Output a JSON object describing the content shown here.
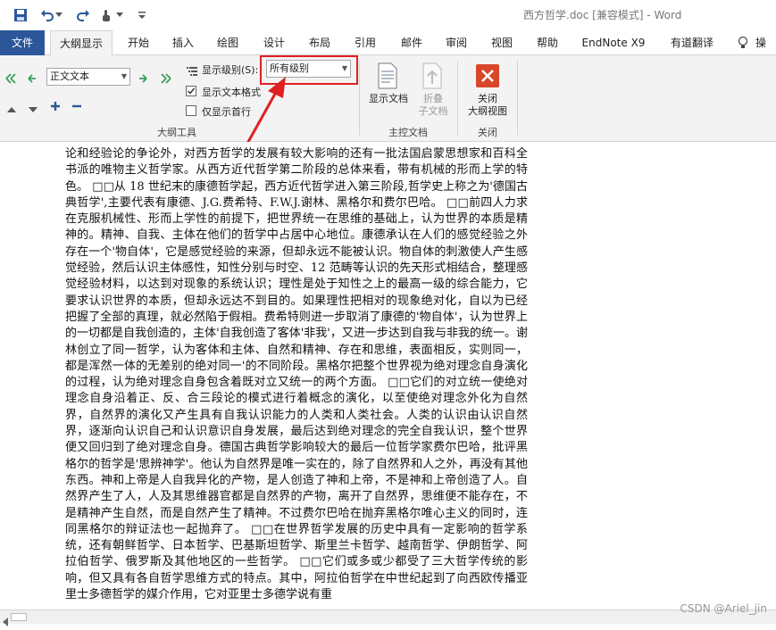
{
  "window": {
    "title": "西方哲学.doc [兼容模式] - Word"
  },
  "tabs": [
    {
      "label": "文件"
    },
    {
      "label": "大纲显示"
    },
    {
      "label": "开始"
    },
    {
      "label": "插入"
    },
    {
      "label": "绘图"
    },
    {
      "label": "设计"
    },
    {
      "label": "布局"
    },
    {
      "label": "引用"
    },
    {
      "label": "邮件"
    },
    {
      "label": "审阅"
    },
    {
      "label": "视图"
    },
    {
      "label": "帮助"
    },
    {
      "label": "EndNote X9"
    },
    {
      "label": "有道翻译"
    },
    {
      "label": "操"
    }
  ],
  "outline_tools": {
    "level_select": "正文文本",
    "show_level_label": "显示级别(S):",
    "show_level_value": "所有级别",
    "show_text_format": "显示文本格式",
    "first_line_only": "仅显示首行",
    "group_label": "大纲工具"
  },
  "master_doc": {
    "show_doc": "显示文档",
    "collapse_line1": "折叠",
    "collapse_line2": "子文档",
    "group_label": "主控文档"
  },
  "close_group": {
    "close_line1": "关闭",
    "close_line2": "大纲视图",
    "group_label": "关闭"
  },
  "document": {
    "paragraph": "论和经验论的争论外，对西方哲学的发展有较大影响的还有一批法国启蒙思想家和百科全书派的唯物主义哲学家。从西方近代哲学第二阶段的总体来看，带有机械的形而上学的特色。 □□从 18 世纪末的康德哲学起，西方近代哲学进入第三阶段,哲学史上称之为'德国古典哲学',主要代表有康德、J.G.费希特、F.W.J.谢林、黑格尔和费尔巴哈。 □□前四人力求在克服机械性、形而上学性的前提下，把世界统一在思维的基础上，认为世界的本质是精神的。精神、自我、主体在他们的哲学中占居中心地位。康德承认在人们的感觉经验之外存在一个'物自体'，它是感觉经验的来源，但却永远不能被认识。物自体的刺激使人产生感觉经验，然后认识主体感性，知性分别与时空、12 范畴等认识的先天形式相结合，整理感觉经验材料，以达到对现象的系统认识；理性是处于知性之上的最高一级的综合能力，它要求认识世界的本质，但却永远达不到目的。如果理性把相对的现象绝对化，自以为已经把握了全部的真理，就必然陷于假相。费希特则进一步取消了康德的'物自体'，认为世界上的一切都是自我创造的，主体'自我创造了客体'非我'，又进一步达到自我与非我的统一。谢林创立了同一哲学，认为客体和主体、自然和精神、存在和思维，表面相反，实则同一，都是浑然一体的无差别的绝对同一'的不同阶段。黑格尔把整个世界视为绝对理念自身演化的过程，认为绝对理念自身包含着既对立又统一的两个方面。 □□它们的对立统一使绝对理念自身沿着正、反、合三段论的模式进行着概念的演化，以至使绝对理念外化为自然界，自然界的演化又产生具有自我认识能力的人类和人类社会。人类的认识由认识自然界，逐渐向认识自己和认识意识自身发展，最后达到绝对理念的完全自我认识，整个世界便又回归到了绝对理念自身。德国古典哲学影响较大的最后一位哲学家费尔巴哈，批评黑格尔的哲学是'思辨神学'。他认为自然界是唯一实在的，除了自然界和人之外，再没有其他东西。神和上帝是人自我异化的产物，是人创造了神和上帝，不是神和上帝创造了人。自然界产生了人，人及其思维器官都是自然界的产物，离开了自然界，思维便不能存在，不是精神产生自然，而是自然产生了精神。不过费尔巴哈在抛弃黑格尔唯心主义的同时，连同黑格尔的辩证法也一起抛弃了。 □□在世界哲学发展的历史中具有一定影响的哲学系统，还有朝鲜哲学、日本哲学、巴基斯坦哲学、斯里兰卡哲学、越南哲学、伊朗哲学、阿拉伯哲学、俄罗斯及其他地区的一些哲学。 □□它们或多或少都受了三大哲学传统的影响，但又具有各自哲学思维方式的特点。其中，阿拉伯哲学在中世纪起到了向西欧传播亚里士多德哲学的媒介作用，它对亚里士多德学说有重"
  },
  "watermark": "CSDN @Ariel_jin",
  "colors": {
    "file_tab": "#2b579a",
    "highlight_box": "#e02020",
    "close_icon": "#d9472b"
  }
}
